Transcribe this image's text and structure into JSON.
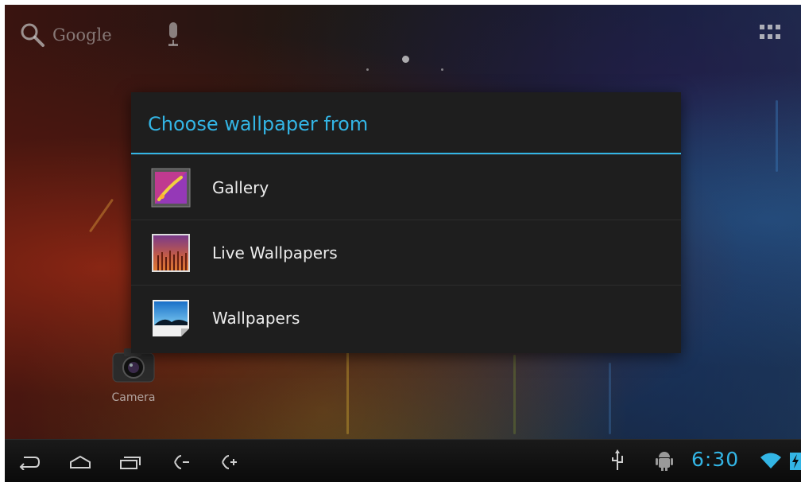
{
  "search": {
    "label": "Google"
  },
  "dialog": {
    "title": "Choose wallpaper from",
    "items": [
      {
        "label": "Gallery",
        "icon": "gallery-icon"
      },
      {
        "label": "Live Wallpapers",
        "icon": "live-wallpapers-icon"
      },
      {
        "label": "Wallpapers",
        "icon": "wallpapers-icon"
      }
    ]
  },
  "desktop": {
    "camera_label": "Camera"
  },
  "status_bar": {
    "time": "6:30"
  },
  "colors": {
    "accent": "#33b5e5",
    "dialog_background": "#1e1e1e",
    "system_bar": "#0a0a0a"
  },
  "icons": [
    "search-icon",
    "mic-icon",
    "apps-grid-icon",
    "back-icon",
    "home-icon",
    "recent-apps-icon",
    "volume-down-icon",
    "volume-up-icon",
    "usb-icon",
    "android-debug-icon",
    "wifi-icon",
    "battery-charging-icon",
    "camera-icon"
  ]
}
